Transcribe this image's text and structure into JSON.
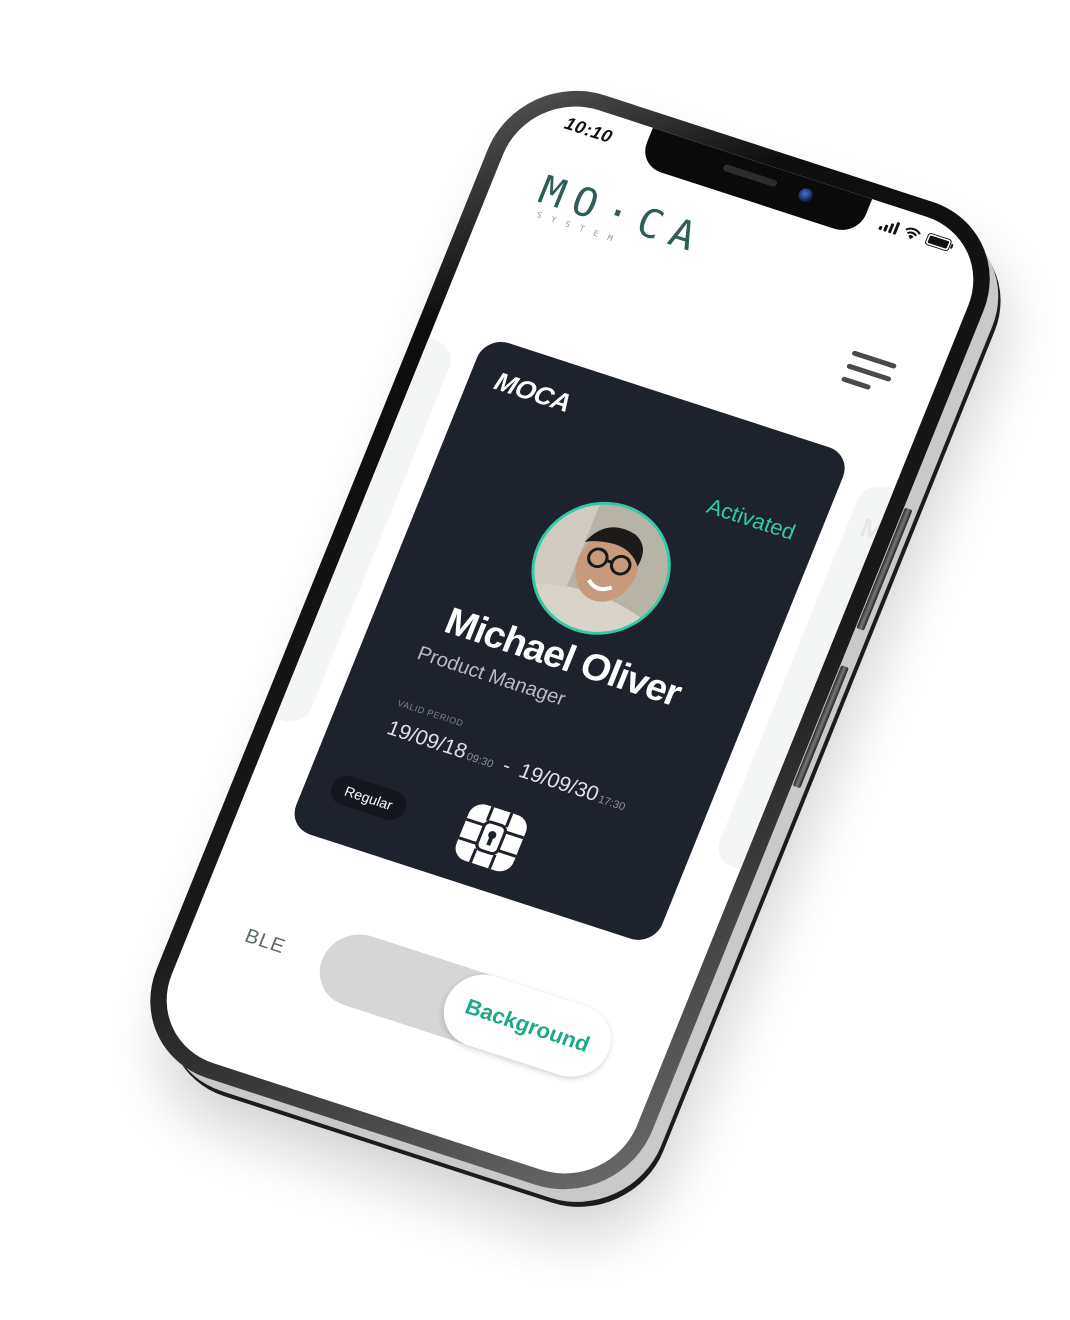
{
  "status_bar": {
    "time": "10:10"
  },
  "header": {
    "logo": "MO·CA",
    "logo_sub": "SYSTEM"
  },
  "ghost_cards": {
    "left_text": "",
    "right_text": "M"
  },
  "card": {
    "brand": "MOCA",
    "status": "Activated",
    "name": "Michael Oliver",
    "role": "Product Manager",
    "period_label": "VALID PERIOD",
    "start_date": "19/09/18",
    "start_time": "09:30",
    "separator": "-",
    "end_date": "19/09/30",
    "end_time": "17:30",
    "tier": "Regular"
  },
  "mode": {
    "label": "BLE",
    "selected": "Background"
  },
  "colors": {
    "accent": "#33c9a6",
    "card_bg": "#1e222c",
    "toggle_text": "#1fa98a"
  },
  "icons": {
    "status": [
      "signal-icon",
      "wifi-icon",
      "battery-icon"
    ],
    "menu": "menu-icon",
    "chip": "chip-icon"
  }
}
